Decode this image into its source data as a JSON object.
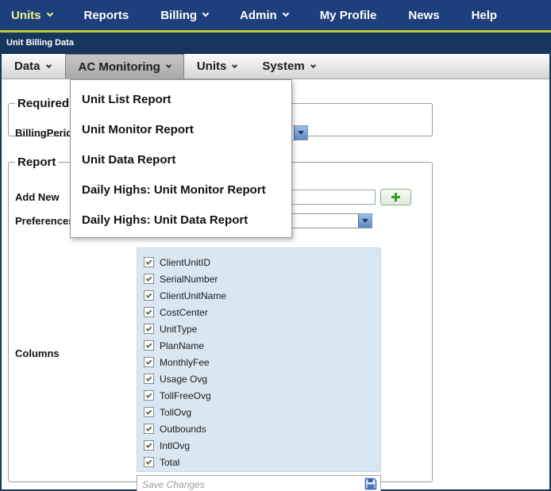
{
  "colors": {
    "nav_bg": "#1d3f7b",
    "accent_green": "#b9cb2f",
    "frame_bg": "#17365e",
    "active_nav_text": "#e9f294",
    "columns_box_bg": "#d9e7f2",
    "combo_arrow_blue": "#5d88c4",
    "plus_green": "#2f9b2f",
    "save_icon_blue": "#2f5fae"
  },
  "topnav": {
    "items": [
      {
        "label": "Units",
        "arrow": true,
        "active": true
      },
      {
        "label": "Reports",
        "arrow": false,
        "active": false
      },
      {
        "label": "Billing",
        "arrow": true,
        "active": false
      },
      {
        "label": "Admin",
        "arrow": true,
        "active": false
      },
      {
        "label": "My Profile",
        "arrow": false,
        "active": false
      },
      {
        "label": "News",
        "arrow": false,
        "active": false
      },
      {
        "label": "Help",
        "arrow": false,
        "active": false
      }
    ]
  },
  "panel": {
    "title": "Unit Billing Data"
  },
  "menubar": {
    "items": [
      {
        "label": "Data",
        "active": false
      },
      {
        "label": "AC Monitoring",
        "active": true
      },
      {
        "label": "Units",
        "active": false
      },
      {
        "label": "System",
        "active": false
      }
    ]
  },
  "dropdown": {
    "items": [
      "Unit List Report",
      "Unit Monitor Report",
      "Unit Data Report",
      "Daily Highs: Unit Monitor Report",
      "Daily Highs: Unit Data Report"
    ]
  },
  "required_section": {
    "legend": "Required",
    "billing_period_label": "BillingPeriod"
  },
  "report_section": {
    "legend": "Report",
    "add_new_label": "Add New",
    "preferences_label": "Preferences",
    "columns_label": "Columns",
    "columns": [
      {
        "label": "ClientUnitID",
        "checked": true
      },
      {
        "label": "SerialNumber",
        "checked": true
      },
      {
        "label": "ClientUnitName",
        "checked": true
      },
      {
        "label": "CostCenter",
        "checked": true
      },
      {
        "label": "UnitType",
        "checked": true
      },
      {
        "label": "PlanName",
        "checked": true
      },
      {
        "label": "MonthlyFee",
        "checked": true
      },
      {
        "label": "Usage Ovg",
        "checked": true
      },
      {
        "label": "TollFreeOvg",
        "checked": true
      },
      {
        "label": "TollOvg",
        "checked": true
      },
      {
        "label": "Outbounds",
        "checked": true
      },
      {
        "label": "IntlOvg",
        "checked": true
      },
      {
        "label": "Total",
        "checked": true
      }
    ],
    "save_placeholder": "Save Changes"
  }
}
